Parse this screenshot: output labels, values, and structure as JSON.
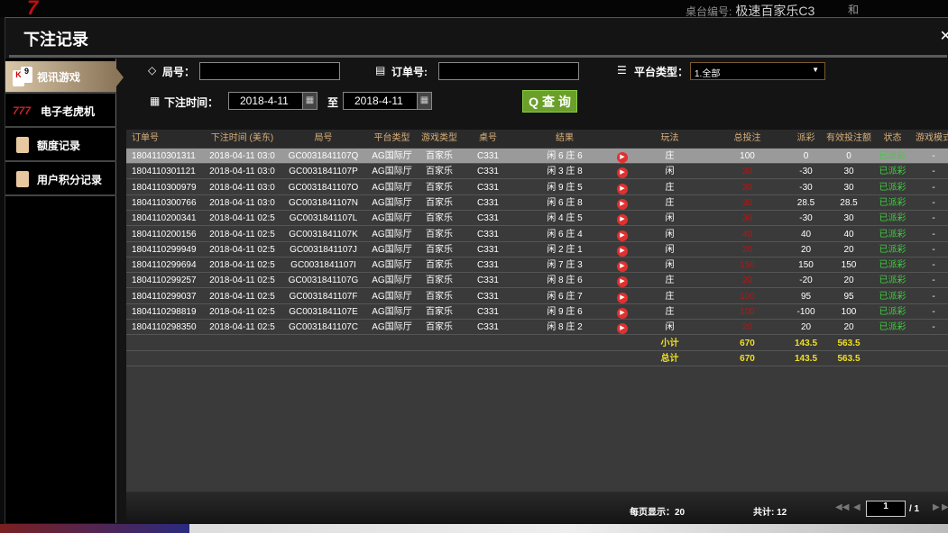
{
  "background": {
    "table_label": "桌台编号:",
    "table_name": "极速百家乐C3",
    "tie": "和"
  },
  "title": "下注记录",
  "sidebar": [
    {
      "label": "视讯游戏",
      "active": true
    },
    {
      "label": "电子老虎机"
    },
    {
      "label": "额度记录"
    },
    {
      "label": "用户积分记录"
    }
  ],
  "filters": {
    "round_label": "局号：",
    "round_value": "",
    "order_label": "订单号:",
    "order_value": "",
    "platform_label": "平台类型：",
    "platform_value": "1.全部",
    "time_label": "下注时间：",
    "date_from": "2018-4-11",
    "to": "至",
    "date_to": "2018-4-11",
    "query": "查 询"
  },
  "columns": [
    "订单号",
    "下注时间 (美东)",
    "局号",
    "平台类型",
    "游戏类型",
    "桌号",
    "结果",
    "",
    "玩法",
    "总投注",
    "派彩",
    "有效投注额",
    "状态",
    "游戏模式"
  ],
  "rows": [
    [
      "1804110301311",
      "2018-04-11 03:0",
      "GC0031841107Q",
      "AG国际厅",
      "百家乐",
      "C331",
      "闲 6 庄 6",
      "庄",
      "100",
      "0",
      "0",
      "已派彩",
      "-"
    ],
    [
      "1804110301121",
      "2018-04-11 03:0",
      "GC0031841107P",
      "AG国际厅",
      "百家乐",
      "C331",
      "闲 3 庄 8",
      "闲",
      "30",
      "-30",
      "30",
      "已派彩",
      "-"
    ],
    [
      "1804110300979",
      "2018-04-11 03:0",
      "GC0031841107O",
      "AG国际厅",
      "百家乐",
      "C331",
      "闲 9 庄 5",
      "庄",
      "30",
      "-30",
      "30",
      "已派彩",
      "-"
    ],
    [
      "1804110300766",
      "2018-04-11 03:0",
      "GC0031841107N",
      "AG国际厅",
      "百家乐",
      "C331",
      "闲 6 庄 8",
      "庄",
      "30",
      "28.5",
      "28.5",
      "已派彩",
      "-"
    ],
    [
      "1804110200341",
      "2018-04-11 02:5",
      "GC0031841107L",
      "AG国际厅",
      "百家乐",
      "C331",
      "闲 4 庄 5",
      "闲",
      "30",
      "-30",
      "30",
      "已派彩",
      "-"
    ],
    [
      "1804110200156",
      "2018-04-11 02:5",
      "GC0031841107K",
      "AG国际厅",
      "百家乐",
      "C331",
      "闲 6 庄 4",
      "闲",
      "40",
      "40",
      "40",
      "已派彩",
      "-"
    ],
    [
      "1804110299949",
      "2018-04-11 02:5",
      "GC0031841107J",
      "AG国际厅",
      "百家乐",
      "C331",
      "闲 2 庄 1",
      "闲",
      "20",
      "20",
      "20",
      "已派彩",
      "-"
    ],
    [
      "1804110299694",
      "2018-04-11 02:5",
      "GC0031841107I",
      "AG国际厅",
      "百家乐",
      "C331",
      "闲 7 庄 3",
      "闲",
      "150",
      "150",
      "150",
      "已派彩",
      "-"
    ],
    [
      "1804110299257",
      "2018-04-11 02:5",
      "GC0031841107G",
      "AG国际厅",
      "百家乐",
      "C331",
      "闲 8 庄 6",
      "庄",
      "20",
      "-20",
      "20",
      "已派彩",
      "-"
    ],
    [
      "1804110299037",
      "2018-04-11 02:5",
      "GC0031841107F",
      "AG国际厅",
      "百家乐",
      "C331",
      "闲 6 庄 7",
      "庄",
      "100",
      "95",
      "95",
      "已派彩",
      "-"
    ],
    [
      "1804110298819",
      "2018-04-11 02:5",
      "GC0031841107E",
      "AG国际厅",
      "百家乐",
      "C331",
      "闲 9 庄 6",
      "庄",
      "100",
      "-100",
      "100",
      "已派彩",
      "-"
    ],
    [
      "1804110298350",
      "2018-04-11 02:5",
      "GC0031841107C",
      "AG国际厅",
      "百家乐",
      "C331",
      "闲 8 庄 2",
      "闲",
      "20",
      "20",
      "20",
      "已派彩",
      "-"
    ]
  ],
  "subtotal": {
    "label": "小计",
    "bet": "670",
    "payout": "143.5",
    "valid": "563.5"
  },
  "total": {
    "label": "总计",
    "bet": "670",
    "payout": "143.5",
    "valid": "563.5"
  },
  "footer": {
    "per_page": "每页显示：20",
    "count": "共计: 12",
    "page": "1",
    "pages": "/ 1"
  }
}
